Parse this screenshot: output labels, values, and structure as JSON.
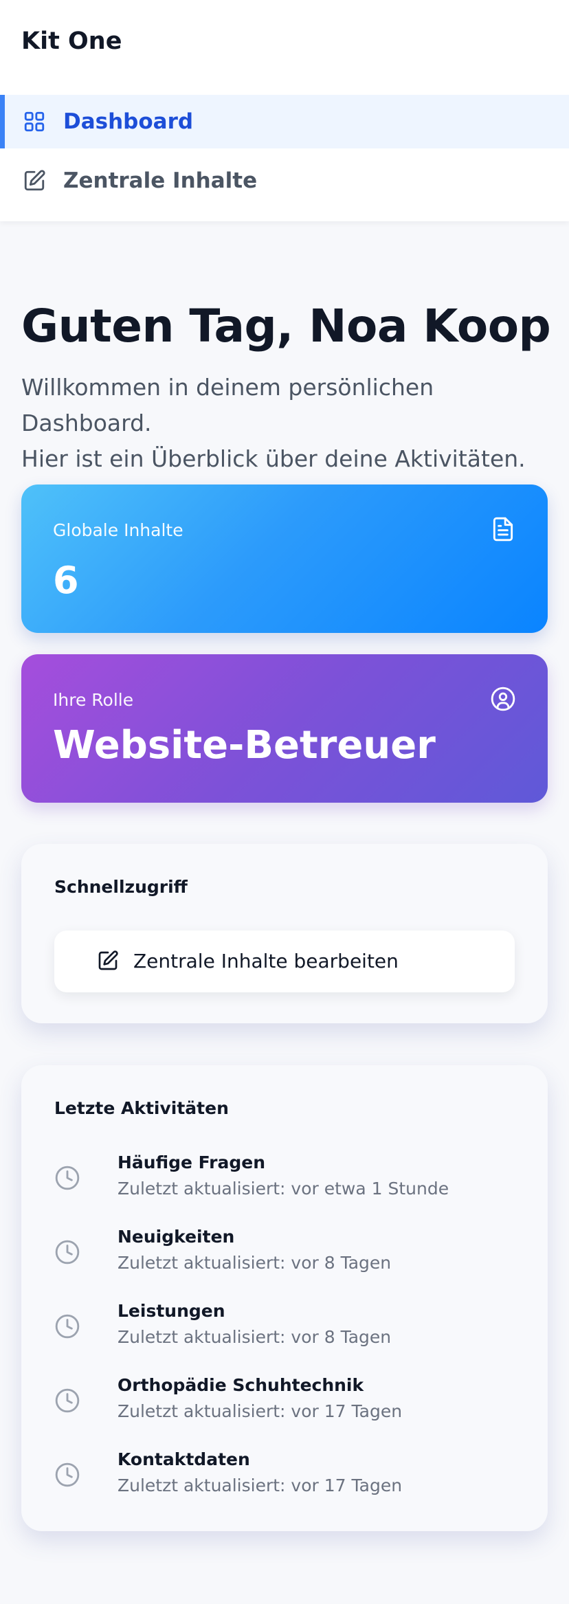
{
  "app": {
    "title": "Kit One"
  },
  "nav": {
    "items": [
      {
        "label": "Dashboard",
        "icon": "grid-icon",
        "active": true
      },
      {
        "label": "Zentrale Inhalte",
        "icon": "edit-icon",
        "active": false
      }
    ]
  },
  "header": {
    "greeting": "Guten Tag, Noa Koop",
    "subtitle_line1": "Willkommen in deinem persönlichen Dashboard.",
    "subtitle_line2": "Hier ist ein Überblick über deine Aktivitäten."
  },
  "stats": {
    "global": {
      "label": "Globale Inhalte",
      "value": "6",
      "icon": "document-icon"
    },
    "role": {
      "label": "Ihre Rolle",
      "value": "Website-Betreuer",
      "icon": "user-circle-icon"
    }
  },
  "quick": {
    "title": "Schnellzugriff",
    "button_label": "Zentrale Inhalte bearbeiten",
    "button_icon": "edit-icon"
  },
  "activity": {
    "title": "Letzte Aktivitäten",
    "items": [
      {
        "name": "Häufige Fragen",
        "meta": "Zuletzt aktualisiert: vor etwa 1 Stunde"
      },
      {
        "name": "Neuigkeiten",
        "meta": "Zuletzt aktualisiert: vor 8 Tagen"
      },
      {
        "name": "Leistungen",
        "meta": "Zuletzt aktualisiert: vor 8 Tagen"
      },
      {
        "name": "Orthopädie Schuhtechnik",
        "meta": "Zuletzt aktualisiert: vor 17 Tagen"
      },
      {
        "name": "Kontaktdaten",
        "meta": "Zuletzt aktualisiert: vor 17 Tagen"
      }
    ]
  },
  "colors": {
    "accent": "#3b82f6",
    "nav_active_bg": "#eef5ff",
    "blue_card_start": "#4fc1f9",
    "blue_card_end": "#0a84ff",
    "purple_card_start": "#a54edc",
    "purple_card_end": "#5f59d8"
  }
}
